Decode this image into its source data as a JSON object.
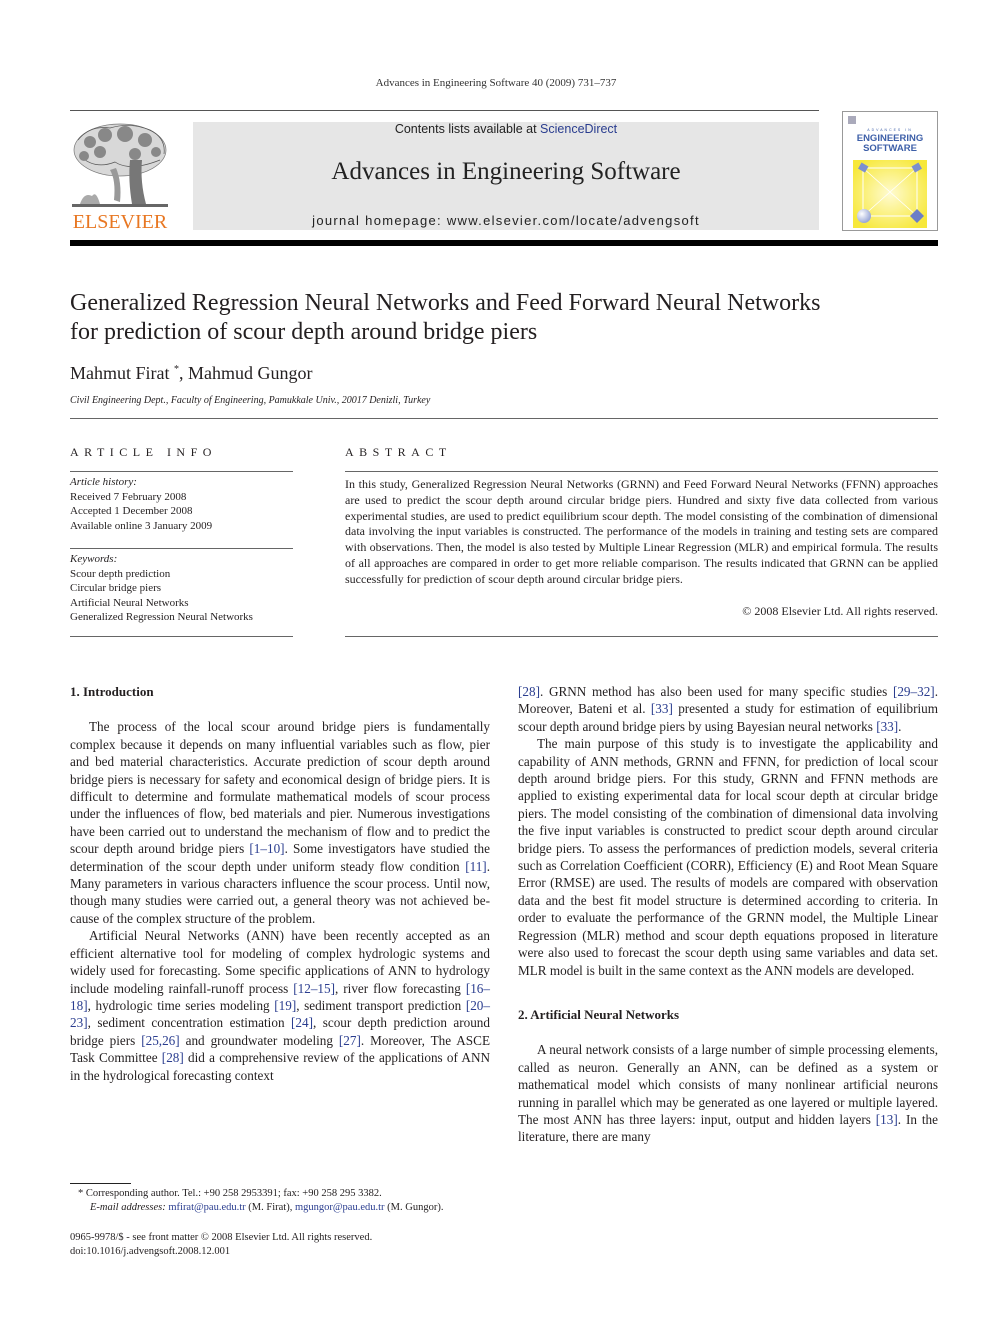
{
  "running_head": "Advances in Engineering Software 40 (2009) 731–737",
  "masthead": {
    "publisher_logo_text": "ELSEVIER",
    "contents_prefix": "Contents lists available at ",
    "contents_link": "ScienceDirect",
    "journal_name": "Advances in Engineering Software",
    "homepage": "journal homepage: www.elsevier.com/locate/advengsoft",
    "cover": {
      "small_line": "ADVANCES IN",
      "title_line1": "ENGINEERING",
      "title_line2": "SOFTWARE"
    },
    "colors": {
      "elsevier_orange": "#e87722",
      "banner_gray": "#e6e6e6",
      "link_blue": "#2a3d8f",
      "cover_yellow": "#f7e83a"
    }
  },
  "article": {
    "title_line1": "Generalized Regression Neural Networks and Feed Forward Neural Networks",
    "title_line2": "for prediction of scour depth around bridge piers",
    "author1": "Mahmut Firat",
    "author1_mark": "*",
    "author_sep": ", ",
    "author2": "Mahmud Gungor",
    "affiliation": "Civil Engineering Dept., Faculty of Engineering, Pamukkale Univ., 20017 Denizli, Turkey"
  },
  "article_info": {
    "heading": "ARTICLE INFO",
    "history_label": "Article history:",
    "history": [
      "Received 7 February 2008",
      "Accepted 1 December 2008",
      "Available online 3 January 2009"
    ],
    "keywords_label": "Keywords:",
    "keywords": [
      "Scour depth prediction",
      "Circular bridge piers",
      "Artificial Neural Networks",
      "Generalized Regression Neural Networks"
    ]
  },
  "abstract": {
    "heading": "ABSTRACT",
    "text": "In this study, Generalized Regression Neural Networks (GRNN) and Feed Forward Neural Networks (FFNN) approaches are used to predict the scour depth around circular bridge piers. Hundred and sixty five data collected from various experimental studies, are used to predict equilibrium scour depth. The model consisting of the combination of dimensional data involving the input variables is constructed. The performance of the models in training and testing sets are compared with observations. Then, the model is also tested by Multiple Linear Regression (MLR) and empirical formula. The results of all approaches are compared in order to get more reliable comparison. The results indicated that GRNN can be applied successfully for prediction of scour depth around circular bridge piers.",
    "copyright": "© 2008 Elsevier Ltd. All rights reserved."
  },
  "body": {
    "sec1_heading": "1. Introduction",
    "p1": [
      {
        "t": "The process of the local scour around bridge piers is fundamen­tally complex because it depends on many influential variables such as flow, pier and bed material characteristics. Accurate pre­diction of scour depth around bridge piers is necessary for safety and economical design of bridge piers. It is difficult to determine and formulate mathematical models of scour process under the influences of flow, bed materials and pier. Numerous investigations have been carried out to understand the mechanism of flow and to predict the scour depth around bridge piers "
      },
      {
        "ref": "[1–10]"
      },
      {
        "t": ". Some investi­gators have studied the determination of the scour depth under uniform steady flow condition "
      },
      {
        "ref": "[11]"
      },
      {
        "t": ". Many parameters in various characters influence the scour process. Until now, though many studies were carried out, a general theory was not achieved be­cause of the complex structure of the problem."
      }
    ],
    "p2": [
      {
        "t": "Artificial Neural Networks (ANN) have been recently accepted as an efficient alternative tool for modeling of complex hydrologic systems and widely used for forecasting. Some specific applica­tions of ANN to hydrology include modeling rainfall-runoff process "
      },
      {
        "ref": "[12–15]"
      },
      {
        "t": ", river flow forecasting "
      },
      {
        "ref": "[16–18]"
      },
      {
        "t": ", hydrologic time series modeling "
      },
      {
        "ref": "[19]"
      },
      {
        "t": ", sediment transport prediction "
      },
      {
        "ref": "[20–23]"
      },
      {
        "t": ", sediment concentration estimation "
      },
      {
        "ref": "[24]"
      },
      {
        "t": ", scour depth prediction around bridge piers "
      },
      {
        "ref": "[25,26]"
      },
      {
        "t": " and groundwater modeling "
      },
      {
        "ref": "[27]"
      },
      {
        "t": ". Moreover, The ASCE Task Committee "
      },
      {
        "ref": "[28]"
      },
      {
        "t": " did a comprehensive review of the applications of ANN in the hydrological forecasting context "
      }
    ],
    "p2_cont": [
      {
        "ref": "[28]"
      },
      {
        "t": ". GRNN method has also been used for many specific studies "
      },
      {
        "ref": "[29–32]"
      },
      {
        "t": ". Moreover, Bateni et al. "
      },
      {
        "ref": "[33]"
      },
      {
        "t": " presented a study for estima­tion of equilibrium scour depth around bridge piers by using Bayesian neural networks "
      },
      {
        "ref": "[33]"
      },
      {
        "t": "."
      }
    ],
    "p3": [
      {
        "t": "The main purpose of this study is to investigate the applicability and capability of ANN methods, GRNN and FFNN, for prediction of local scour depth around bridge piers. For this study, GRNN and FFNN methods are applied to existing experimental data for local scour depth at circular bridge piers. The model consisting of the combination of dimensional data involving the five input variables is constructed to predict scour depth around circular bridge piers. To assess the performances of prediction models, several criteria such as Correlation Coefficient (CORR), Efficiency (E) and Root Mean Square Error (RMSE) are used. The results of models are com­pared with observation data and the best fit model structure is determined according to criteria. In order to evaluate the perfor­mance of the GRNN model, the Multiple Linear Regression (MLR) method and scour depth equations proposed in literature were also used to forecast the scour depth using same variables and data set. MLR model is built in the same context as the ANN models are developed."
      }
    ],
    "sec2_heading": "2. Artificial Neural Networks",
    "p4": [
      {
        "t": "A neural network consists of a large number of simple process­ing elements, called as neuron. Generally an ANN, can be defined as a system or mathematical model which consists of many nonlinear artificial neurons running in parallel which may be generated as one layered or multiple layered. The most ANN has three layers: in­put, output and hidden layers "
      },
      {
        "ref": "[13]"
      },
      {
        "t": ". In the literature, there are many"
      }
    ]
  },
  "footnote": {
    "mark": "*",
    "corresponding": "Corresponding author. Tel.: +90 258 2953391; fax: +90 258 295 3382.",
    "email_label": "E-mail addresses:",
    "email1": "mfirat@pau.edu.tr",
    "email1_name": " (M. Firat), ",
    "email2": "mgungor@pau.edu.tr",
    "email2_name": " (M. Gungor)."
  },
  "issn": {
    "line1": "0965-9978/$ - see front matter © 2008 Elsevier Ltd. All rights reserved.",
    "line2": "doi:10.1016/j.advengsoft.2008.12.001"
  }
}
